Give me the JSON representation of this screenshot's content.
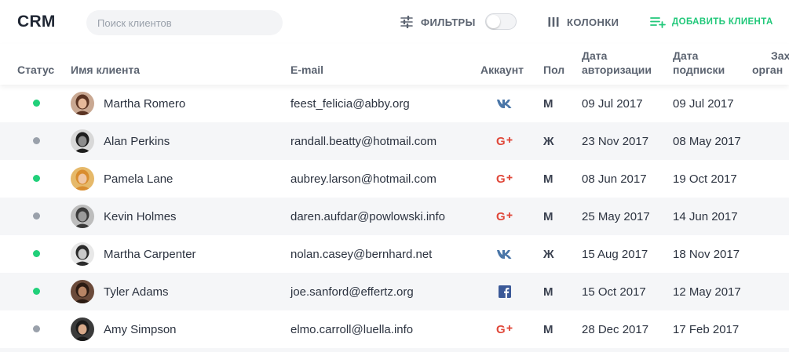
{
  "app": {
    "logo": "CRM"
  },
  "search": {
    "placeholder": "Поиск клиентов",
    "value": ""
  },
  "toolbar": {
    "filters_label": "ФИЛЬТРЫ",
    "filters_toggle_on": false,
    "columns_label": "КОЛОНКИ",
    "add_label": "ДОБАВИТЬ КЛИЕНТА"
  },
  "colors": {
    "online": "#21d07a",
    "offline": "#9aa1ab",
    "accent_green": "#21c87a",
    "vk": "#4a76a8",
    "google": "#e0483a",
    "facebook": "#3b5998"
  },
  "table": {
    "headers": {
      "status": "Статус",
      "name": "Имя клиента",
      "email": "E-mail",
      "account": "Аккаунт",
      "sex": "Пол",
      "auth_line1": "Дата",
      "auth_line2": "авторизации",
      "sub_line1": "Дата",
      "sub_line2": "подписки",
      "org_line1": "Зах",
      "org_line2": "орган"
    },
    "rows": [
      {
        "online": true,
        "avatar": "avatar-martha-romero",
        "name": "Martha Romero",
        "email": "feest_felicia@abby.org",
        "account": "vk-icon",
        "sex": "М",
        "auth": "09 Jul 2017",
        "sub": "09 Jul 2017"
      },
      {
        "online": false,
        "avatar": "avatar-alan-perkins",
        "name": "Alan Perkins",
        "email": "randall.beatty@hotmail.com",
        "account": "google-plus-icon",
        "sex": "Ж",
        "auth": "23 Nov 2017",
        "sub": "08 May 2017"
      },
      {
        "online": true,
        "avatar": "avatar-pamela-lane",
        "name": "Pamela Lane",
        "email": "aubrey.larson@hotmail.com",
        "account": "google-plus-icon",
        "sex": "М",
        "auth": "08 Jun 2017",
        "sub": "19 Oct 2017"
      },
      {
        "online": false,
        "avatar": "avatar-kevin-holmes",
        "name": "Kevin Holmes",
        "email": "daren.aufdar@powlowski.info",
        "account": "google-plus-icon",
        "sex": "М",
        "auth": "25 May 2017",
        "sub": "14 Jun 2017"
      },
      {
        "online": true,
        "avatar": "avatar-martha-carpenter",
        "name": "Martha Carpenter",
        "email": "nolan.casey@bernhard.net",
        "account": "vk-icon",
        "sex": "Ж",
        "auth": "15 Aug 2017",
        "sub": "18 Nov 2017"
      },
      {
        "online": true,
        "avatar": "avatar-tyler-adams",
        "name": "Tyler Adams",
        "email": "joe.sanford@effertz.org",
        "account": "facebook-icon",
        "sex": "М",
        "auth": "15 Oct 2017",
        "sub": "12 May 2017"
      },
      {
        "online": false,
        "avatar": "avatar-amy-simpson",
        "name": "Amy Simpson",
        "email": "elmo.carroll@luella.info",
        "account": "google-plus-icon",
        "sex": "М",
        "auth": "28 Dec 2017",
        "sub": "17 Feb 2017"
      }
    ]
  }
}
